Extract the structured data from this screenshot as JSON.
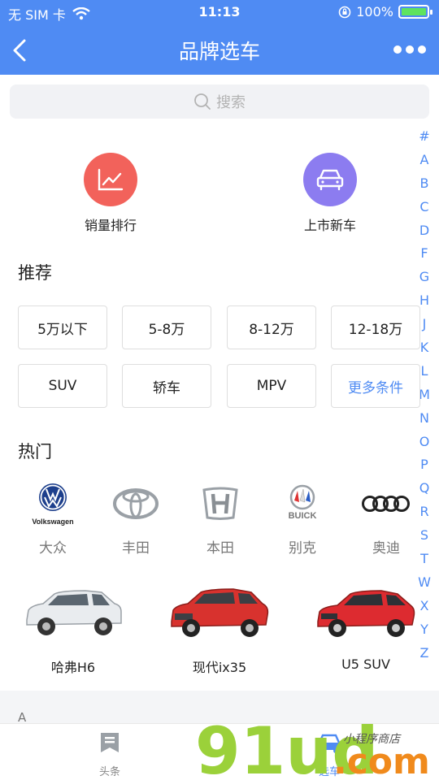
{
  "status_bar": {
    "carrier": "无 SIM 卡",
    "time": "11:13",
    "battery": "100%"
  },
  "nav": {
    "title": "品牌选车"
  },
  "search": {
    "placeholder": "搜索"
  },
  "index_letters": [
    "#",
    "A",
    "B",
    "C",
    "D",
    "F",
    "G",
    "H",
    "J",
    "K",
    "L",
    "M",
    "N",
    "O",
    "P",
    "Q",
    "R",
    "S",
    "T",
    "W",
    "X",
    "Y",
    "Z"
  ],
  "shortcuts": [
    {
      "label": "销量排行",
      "icon": "chart-icon",
      "color": "#f2625b"
    },
    {
      "label": "上市新车",
      "icon": "new-car-icon",
      "color": "#8c7cf0"
    }
  ],
  "recommend": {
    "title": "推荐",
    "chips": [
      "5万以下",
      "5-8万",
      "8-12万",
      "12-18万",
      "SUV",
      "轿车",
      "MPV",
      "更多条件"
    ]
  },
  "hot": {
    "title": "热门",
    "brands": [
      {
        "name": "大众",
        "logo_text": "Volkswagen"
      },
      {
        "name": "丰田"
      },
      {
        "name": "本田"
      },
      {
        "name": "别克",
        "logo_text": "BUICK"
      },
      {
        "name": "奥迪"
      }
    ]
  },
  "cars": [
    {
      "name": "哈弗H6",
      "color": "#e9ecef"
    },
    {
      "name": "现代ix35",
      "color": "#d8322e"
    },
    {
      "name": "U5 SUV",
      "color": "#dd2b30"
    }
  ],
  "section_letter": "A",
  "tabs": [
    {
      "label": "头条",
      "icon": "news-icon"
    },
    {
      "label": "选车",
      "icon": "car-icon"
    }
  ],
  "watermark": {
    "text": "91ud",
    "suffix": ".com",
    "tagline": "小程序商店"
  }
}
